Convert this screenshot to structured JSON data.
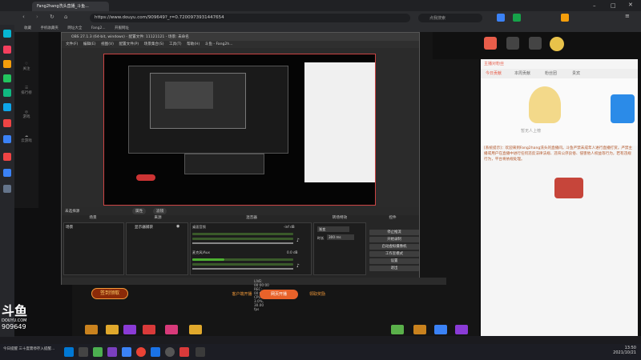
{
  "browser": {
    "tab_title": "Fang2hang洗头直播_斗鱼...",
    "url": "https://www.douyu.com/909649?_r=0.7200973931447654",
    "search_placeholder": "点我搜索",
    "bookmarks": [
      "收藏",
      "手机收藏夹",
      "网址大全",
      "Fang2...",
      "开服网址"
    ]
  },
  "site_nav": [
    "关注",
    "排行榜",
    "游戏",
    "云游戏"
  ],
  "obs": {
    "title": "OBS 27.1.3 (64-bit, windows) - 配置文件: 11121121 - 场景: 未命名",
    "menu": [
      "文件(F)",
      "编辑(E)",
      "视图(V)",
      "配置文件(P)",
      "场景集合(S)",
      "工具(T)",
      "帮助(H)",
      "斗鱼 - Fang2h..."
    ],
    "scene_label": "未选择源",
    "scene_props": "属性",
    "scene_filters": "滤镜",
    "docks": {
      "scenes": "场景",
      "sources": "来源",
      "mixer": "混音器",
      "transitions": "转场特效",
      "controls": "控件"
    },
    "scene_item": "场景",
    "source_item": "显示器捕获",
    "mixer_tracks": [
      {
        "name": "桌面音频",
        "db": "-inf dB"
      },
      {
        "name": "麦克风/Aux",
        "db": "0.0 dB"
      }
    ],
    "transition": {
      "type": "渐变",
      "duration_label": "时长",
      "duration": "300 ms"
    },
    "controls": [
      "停止推流",
      "开始录制",
      "启动虚拟摄像机",
      "工作室模式",
      "设置",
      "退出"
    ],
    "status": "LIVE: 00:00:00   REC: 00:00:00   CPU: 3.0%, 30.00 fps"
  },
  "chat": {
    "tabs": [
      "今日贡献",
      "本周贡献",
      "粉丝团",
      "贵宾"
    ],
    "rank_title": "主播对粉丝",
    "rank_hint": "暂无人上榜",
    "notice": "[系统提示]：欢迎来到Fang2hang洗头的直播间。斗鱼严禁未成年人进行直播打赏。严禁主播或用户在直播中进行任何违反法律法规、违背公序良俗、侵害他人权益等行为，若有违规行为，平台将依规处理。"
  },
  "bottom_bar": {
    "signin": "签到领取",
    "btn1": "客户端开播",
    "btn2": "网页开播",
    "btn3": "领取奖励"
  },
  "logo": {
    "brand": "斗鱼",
    "sub": "DOUYU.COM",
    "room": "909649"
  },
  "taskbar": {
    "clock_time": "13:50",
    "clock_date": "2021/10/21",
    "weather": "今日提醒 三十度需停存入提醒..."
  }
}
